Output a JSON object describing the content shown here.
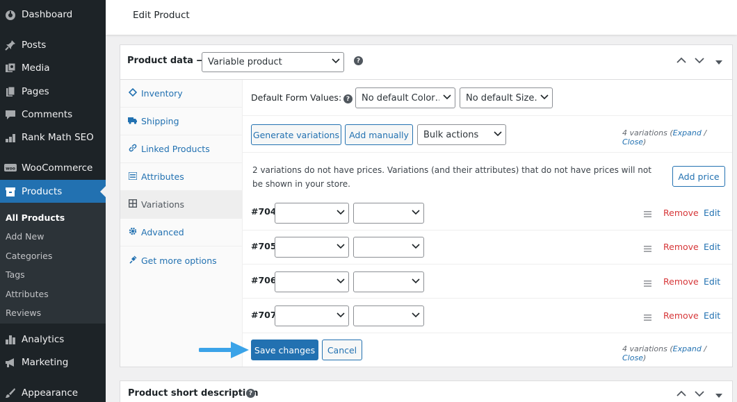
{
  "sidebar": {
    "items": [
      {
        "label": "Dashboard",
        "icon": "dashboard-icon"
      },
      {
        "label": "Posts",
        "icon": "pin-icon"
      },
      {
        "label": "Media",
        "icon": "media-icon"
      },
      {
        "label": "Pages",
        "icon": "pages-icon"
      },
      {
        "label": "Comments",
        "icon": "comment-icon"
      },
      {
        "label": "Rank Math SEO",
        "icon": "rank-math-icon"
      },
      {
        "label": "WooCommerce",
        "icon": "woocommerce-icon"
      },
      {
        "label": "Products",
        "icon": "archive-icon"
      },
      {
        "label": "Analytics",
        "icon": "bar-chart-icon"
      },
      {
        "label": "Marketing",
        "icon": "megaphone-icon"
      },
      {
        "label": "Appearance",
        "icon": "brush-icon"
      }
    ],
    "submenu": [
      "All Products",
      "Add New",
      "Categories",
      "Tags",
      "Attributes",
      "Reviews"
    ]
  },
  "header": {
    "title": "Edit Product"
  },
  "product_data": {
    "title": "Product data —",
    "type_select": "Variable product",
    "tabs": [
      {
        "label": "Inventory",
        "icon": "tag-icon"
      },
      {
        "label": "Shipping",
        "icon": "truck-icon"
      },
      {
        "label": "Linked Products",
        "icon": "link-icon"
      },
      {
        "label": "Attributes",
        "icon": "list-icon"
      },
      {
        "label": "Variations",
        "icon": "grid-icon"
      },
      {
        "label": "Advanced",
        "icon": "gear-icon"
      },
      {
        "label": "Get more options",
        "icon": "plugin-icon"
      }
    ],
    "default_form_label": "Default Form Values:",
    "default_color": "No default Color…",
    "default_size": "No default Size…",
    "generate_btn": "Generate variations",
    "add_manually_btn": "Add manually",
    "bulk_actions": "Bulk actions",
    "variations_count": "4 variations",
    "expand": "Expand",
    "slash": "/",
    "close": "Close",
    "notice": "2 variations do not have prices. Variations (and their attributes) that do not have prices will not be shown in your store.",
    "add_price_btn": "Add price",
    "variations": [
      {
        "id": "#704",
        "remove": "Remove",
        "edit": "Edit"
      },
      {
        "id": "#705",
        "remove": "Remove",
        "edit": "Edit"
      },
      {
        "id": "#706",
        "remove": "Remove",
        "edit": "Edit"
      },
      {
        "id": "#707",
        "remove": "Remove",
        "edit": "Edit"
      }
    ],
    "save_btn": "Save changes",
    "cancel_btn": "Cancel"
  },
  "short_description": {
    "title": "Product short description"
  },
  "colors": {
    "accent": "#2271b1",
    "sidebar": "#1d2327",
    "remove": "#d63638",
    "annotation_arrow": "#3ba3e8"
  }
}
